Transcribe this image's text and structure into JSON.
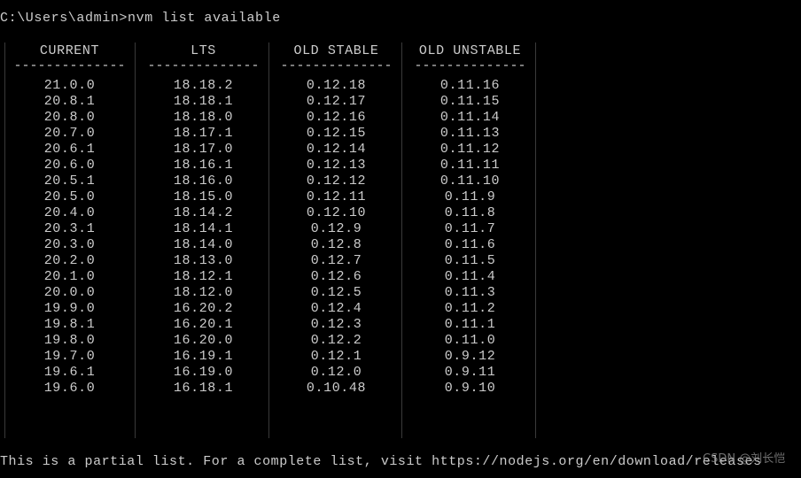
{
  "terminal": {
    "prompt_line": "C:\\Users\\admin>nvm list available",
    "footer_line": "This is a partial list. For a complete list, visit https://nodejs.org/en/download/releases",
    "watermark": "CSDN @刘长恺",
    "background_color": "#000000",
    "text_color": "#cccccc",
    "rule_color": "#3a3a3a"
  },
  "table": {
    "dash_rule": "--------------",
    "headers": [
      "CURRENT",
      "LTS",
      "OLD STABLE",
      "OLD UNSTABLE"
    ],
    "columns": [
      {
        "header": "CURRENT",
        "values": [
          "21.0.0",
          "20.8.1",
          "20.8.0",
          "20.7.0",
          "20.6.1",
          "20.6.0",
          "20.5.1",
          "20.5.0",
          "20.4.0",
          "20.3.1",
          "20.3.0",
          "20.2.0",
          "20.1.0",
          "20.0.0",
          "19.9.0",
          "19.8.1",
          "19.8.0",
          "19.7.0",
          "19.6.1",
          "19.6.0"
        ]
      },
      {
        "header": "LTS",
        "values": [
          "18.18.2",
          "18.18.1",
          "18.18.0",
          "18.17.1",
          "18.17.0",
          "18.16.1",
          "18.16.0",
          "18.15.0",
          "18.14.2",
          "18.14.1",
          "18.14.0",
          "18.13.0",
          "18.12.1",
          "18.12.0",
          "16.20.2",
          "16.20.1",
          "16.20.0",
          "16.19.1",
          "16.19.0",
          "16.18.1"
        ]
      },
      {
        "header": "OLD STABLE",
        "values": [
          "0.12.18",
          "0.12.17",
          "0.12.16",
          "0.12.15",
          "0.12.14",
          "0.12.13",
          "0.12.12",
          "0.12.11",
          "0.12.10",
          "0.12.9",
          "0.12.8",
          "0.12.7",
          "0.12.6",
          "0.12.5",
          "0.12.4",
          "0.12.3",
          "0.12.2",
          "0.12.1",
          "0.12.0",
          "0.10.48"
        ]
      },
      {
        "header": "OLD UNSTABLE",
        "values": [
          "0.11.16",
          "0.11.15",
          "0.11.14",
          "0.11.13",
          "0.11.12",
          "0.11.11",
          "0.11.10",
          "0.11.9",
          "0.11.8",
          "0.11.7",
          "0.11.6",
          "0.11.5",
          "0.11.4",
          "0.11.3",
          "0.11.2",
          "0.11.1",
          "0.11.0",
          "0.9.12",
          "0.9.11",
          "0.9.10"
        ]
      }
    ]
  }
}
